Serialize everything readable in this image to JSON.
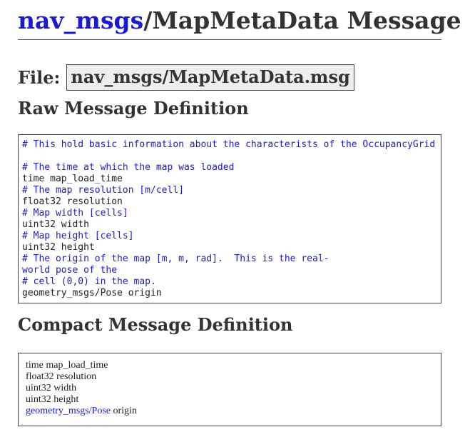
{
  "header": {
    "package_link": "nav_msgs",
    "title_rest": "/MapMetaData Message"
  },
  "file": {
    "label": "File:",
    "name": "nav_msgs/MapMetaData.msg"
  },
  "raw_section": {
    "heading": "Raw Message Definition",
    "lines": [
      {
        "text": "# This hold basic information about the characterists of the OccupancyGrid",
        "comment": true
      },
      {
        "text": "",
        "comment": false
      },
      {
        "text": "# The time at which the map was loaded",
        "comment": true
      },
      {
        "text": "time map_load_time",
        "comment": false
      },
      {
        "text": "# The map resolution [m/cell]",
        "comment": true
      },
      {
        "text": "float32 resolution",
        "comment": false
      },
      {
        "text": "# Map width [cells]",
        "comment": true
      },
      {
        "text": "uint32 width",
        "comment": false
      },
      {
        "text": "# Map height [cells]",
        "comment": true
      },
      {
        "text": "uint32 height",
        "comment": false
      },
      {
        "text": "# The origin of the map [m, m, rad].  This is the real-",
        "comment": true
      },
      {
        "text": "world pose of the",
        "comment": true
      },
      {
        "text": "# cell (0,0) in the map.",
        "comment": true
      },
      {
        "text": "geometry_msgs/Pose origin",
        "comment": false
      }
    ]
  },
  "compact_section": {
    "heading": "Compact Message Definition",
    "lines": [
      {
        "type": "time",
        "name": "map_load_time",
        "type_link": false
      },
      {
        "type": "float32",
        "name": "resolution",
        "type_link": false
      },
      {
        "type": "uint32",
        "name": "width",
        "type_link": false
      },
      {
        "type": "uint32",
        "name": "height",
        "type_link": false
      },
      {
        "type": "geometry_msgs/Pose",
        "name": "origin",
        "type_link": true
      }
    ]
  }
}
